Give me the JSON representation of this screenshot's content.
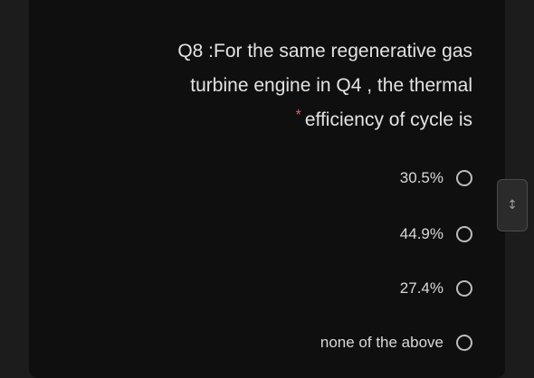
{
  "question": {
    "line1": "Q8 :For the same regenerative gas",
    "line2": "turbine engine in Q4 , the thermal",
    "line3": "efficiency of cycle is",
    "required_marker": "*"
  },
  "options": [
    {
      "label": "30.5%",
      "selected": false
    },
    {
      "label": "44.9%",
      "selected": false
    },
    {
      "label": "27.4%",
      "selected": false
    },
    {
      "label": "none of the above",
      "selected": false
    }
  ],
  "scroll_handle": {
    "icon": "drag-handle-icon",
    "glyph": "↕"
  },
  "colors": {
    "background": "#0f0f10",
    "text": "#e3e3e3",
    "required": "#e06060",
    "radio": "#bdbdbd"
  }
}
